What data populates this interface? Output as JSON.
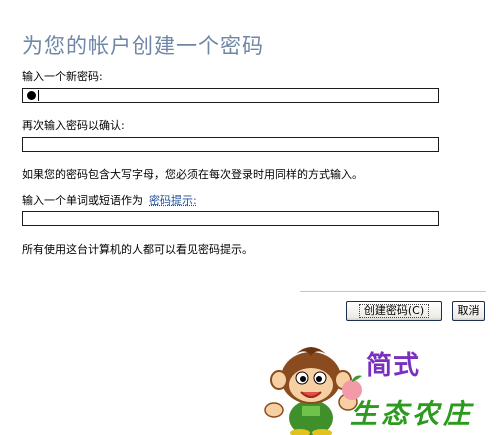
{
  "page": {
    "title": "为您的帐户创建一个密码"
  },
  "form": {
    "new_password_label": "输入一个新密码:",
    "confirm_label": "再次输入密码以确认:",
    "case_note": "如果您的密码包含大写字母，您必须在每次登录时用同样的方式输入。",
    "hint_label": "输入一个单词或短语作为",
    "hint_link": "密码提示:",
    "visibility_note": "所有使用这台计算机的人都可以看见密码提示。"
  },
  "buttons": {
    "create_label": "创建密码(C)",
    "cancel_label": "取消"
  },
  "watermark": {
    "line1": "简式",
    "line2": "生态农庄"
  },
  "colors": {
    "title": "#6f86a6",
    "link": "#1f4e99",
    "watermark_purple": "#7b2fbe",
    "watermark_green": "#2b9a1e"
  }
}
